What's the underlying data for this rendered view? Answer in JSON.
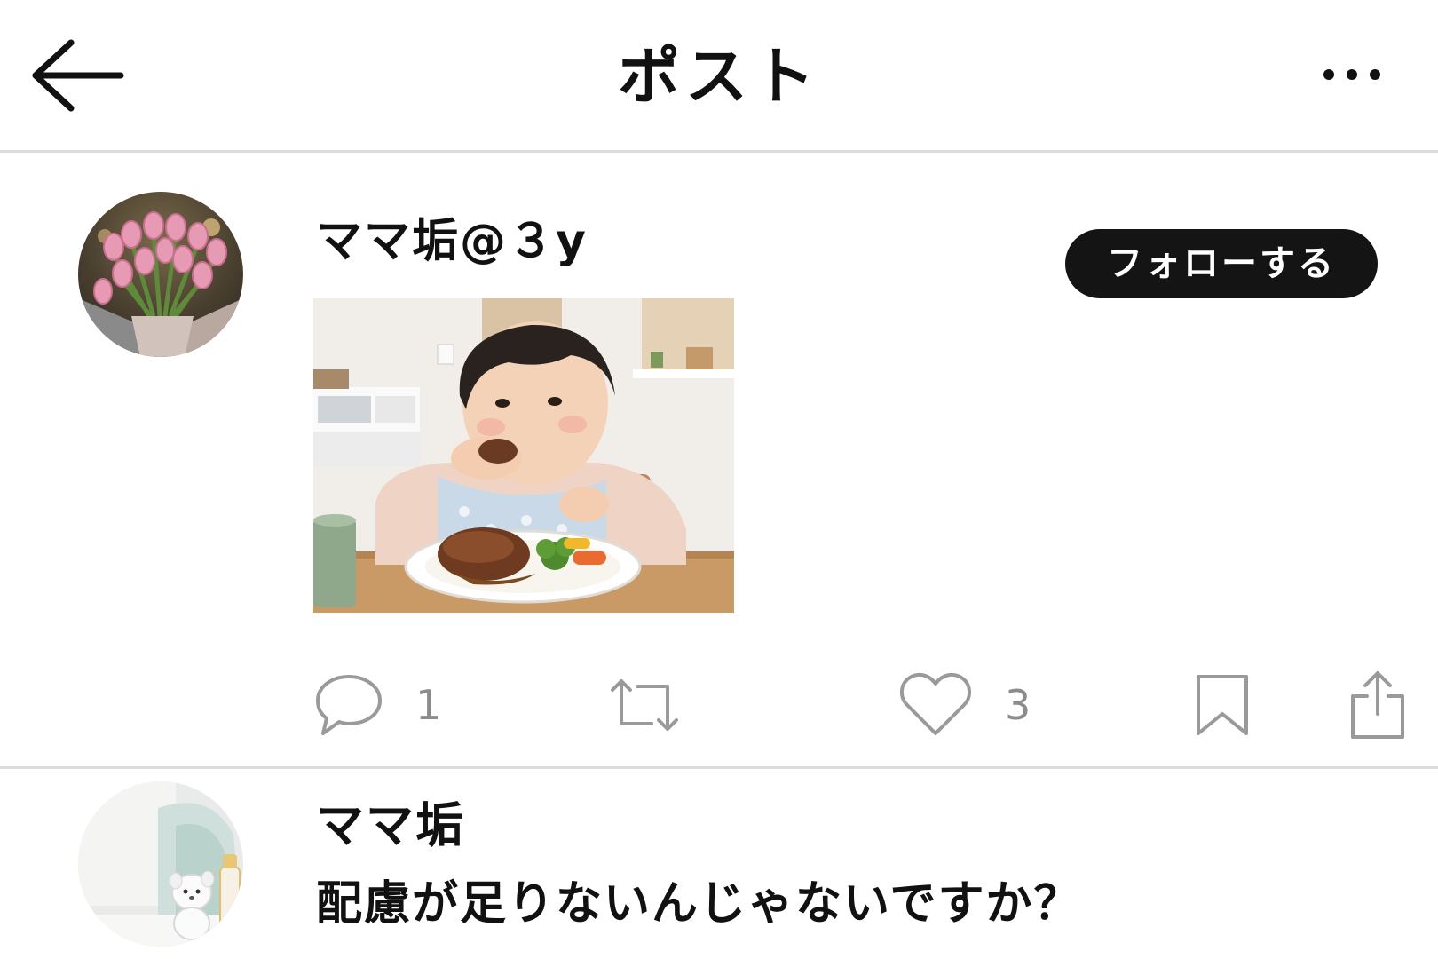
{
  "header": {
    "title": "ポスト",
    "back_icon": "arrow-left-icon",
    "more_icon": "more-horizontal-icon"
  },
  "post": {
    "author_name": "ママ垢@３y",
    "follow_label": "フォローする",
    "image": "photo of a child eating a hamburger steak with vegetables",
    "actions": {
      "reply_icon": "speech-bubble-icon",
      "reply_count": "1",
      "repost_icon": "repost-icon",
      "like_icon": "heart-icon",
      "like_count": "3",
      "bookmark_icon": "bookmark-icon",
      "share_icon": "share-icon"
    }
  },
  "reply": {
    "author_name": "ママ垢",
    "text": "配慮が足りないんじゃないですか？"
  },
  "colors": {
    "text": "#111111",
    "follow_button_bg": "#141414",
    "divider": "#dcdcdc",
    "icon_gray": "#9a9a9a"
  }
}
